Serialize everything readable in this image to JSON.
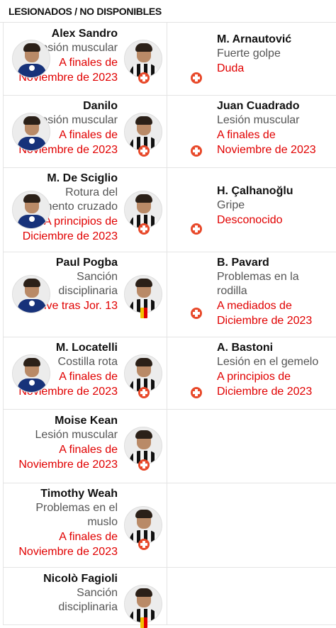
{
  "header": {
    "title": "LESIONADOS / NO DISPONIBLES"
  },
  "icons": {
    "injury": "medical-cross-icon",
    "suspension": "yellow-red-card-icon"
  },
  "colors": {
    "status": "#e10000",
    "injury_badge": "#e8492a",
    "reason": "#555555"
  },
  "rows": [
    {
      "left": {
        "name": "Alex Sandro",
        "reason_lines": [
          "Lesión muscular"
        ],
        "return_lines": [
          "A finales de",
          "Noviembre de 2023"
        ],
        "badge": "injury"
      },
      "right": {
        "name": "M. Arnautović",
        "reason_lines": [
          "Fuerte golpe"
        ],
        "return_lines": [
          "Duda"
        ],
        "badge": "injury"
      }
    },
    {
      "left": {
        "name": "Danilo",
        "reason_lines": [
          "Lesión muscular"
        ],
        "return_lines": [
          "A finales de",
          "Noviembre de 2023"
        ],
        "badge": "injury"
      },
      "right": {
        "name": "Juan Cuadrado",
        "reason_lines": [
          "Lesión muscular"
        ],
        "return_lines": [
          "A finales de",
          "Noviembre de 2023"
        ],
        "badge": "injury"
      }
    },
    {
      "left": {
        "name": "M. De Sciglio",
        "reason_lines": [
          "Rotura del",
          "ligamento cruzado"
        ],
        "return_lines": [
          "A principios de",
          "Diciembre de 2023"
        ],
        "badge": "injury"
      },
      "right": {
        "name": "H. Çalhanoğlu",
        "reason_lines": [
          "Gripe"
        ],
        "return_lines": [
          "Desconocido"
        ],
        "badge": "injury"
      }
    },
    {
      "left": {
        "name": "Paul Pogba",
        "reason_lines": [
          "Sanción",
          "disciplinaria"
        ],
        "return_lines": [
          "Vuelve tras Jor. 13"
        ],
        "badge": "suspension"
      },
      "right": {
        "name": "B. Pavard",
        "reason_lines": [
          "Problemas en la",
          "rodilla"
        ],
        "return_lines": [
          "A mediados de",
          "Diciembre de 2023"
        ],
        "badge": "injury"
      }
    },
    {
      "left": {
        "name": "M. Locatelli",
        "reason_lines": [
          "Costilla rota"
        ],
        "return_lines": [
          "A finales de",
          "Noviembre de 2023"
        ],
        "badge": "injury"
      },
      "right": {
        "name": "A. Bastoni",
        "reason_lines": [
          "Lesión en el gemelo"
        ],
        "return_lines": [
          "A principios de",
          "Diciembre de 2023"
        ],
        "badge": "injury"
      }
    },
    {
      "left": {
        "name": "Moise Kean",
        "reason_lines": [
          "Lesión muscular"
        ],
        "return_lines": [
          "A finales de",
          "Noviembre de 2023"
        ],
        "badge": "injury"
      },
      "right": null
    },
    {
      "left": {
        "name": "Timothy Weah",
        "reason_lines": [
          "Problemas en el",
          "muslo"
        ],
        "return_lines": [
          "A finales de",
          "Noviembre de 2023"
        ],
        "badge": "injury"
      },
      "right": null
    },
    {
      "left": {
        "name": "Nicolò Fagioli",
        "reason_lines": [
          "Sanción",
          "disciplinaria"
        ],
        "return_lines": [],
        "badge": "suspension"
      },
      "right": null
    }
  ]
}
